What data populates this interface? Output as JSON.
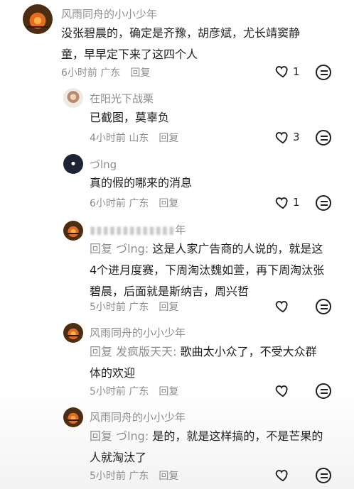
{
  "comments": [
    {
      "user": "风雨同舟的小小少年",
      "text": "没张碧晨的，确定是齐豫，胡彦斌，尤长靖窦静童，早早定下来了这四个人",
      "time": "6小时前 广东",
      "reply": "回复",
      "likes": "1",
      "avatar": "sunset-avatar-icon"
    },
    {
      "user": "在阳光下战栗",
      "text": "已截图，莫辜负",
      "time": "4小时前 山东",
      "reply": "回复",
      "likes": "3",
      "avatar": "person-avatar-icon"
    },
    {
      "user": "づlng",
      "text": "真的假的哪来的消息",
      "time": "6小时前 广东",
      "reply": "回复",
      "likes": "1",
      "avatar": "cartoon-avatar-icon"
    },
    {
      "user": "年",
      "mention": "回复 づlng:",
      "text": " 这是人家广告商的人说的，就是这4个进月度赛，下周淘汰魏如萱，再下周淘汰张碧晨，后面就是斯纳吉，周兴哲",
      "time": "5小时前 广东",
      "reply": "回复",
      "likes": "",
      "avatar": "sunset-avatar-icon"
    },
    {
      "user": "风雨同舟的小小少年",
      "mention": "回复 发疯版天天:",
      "text": " 歌曲太小众了，不受大众群体的欢迎",
      "time": "5小时前 广东",
      "reply": "回复",
      "likes": "",
      "avatar": "sunset-avatar-icon"
    },
    {
      "user": "风雨同舟的小小少年",
      "mention": "回复 づlng:",
      "text": " 是的，就是这样搞的，不是芒果的人就淘汰了",
      "time": "5小时前 广东",
      "reply": "回复",
      "likes": "",
      "avatar": "sunset-avatar-icon"
    }
  ]
}
